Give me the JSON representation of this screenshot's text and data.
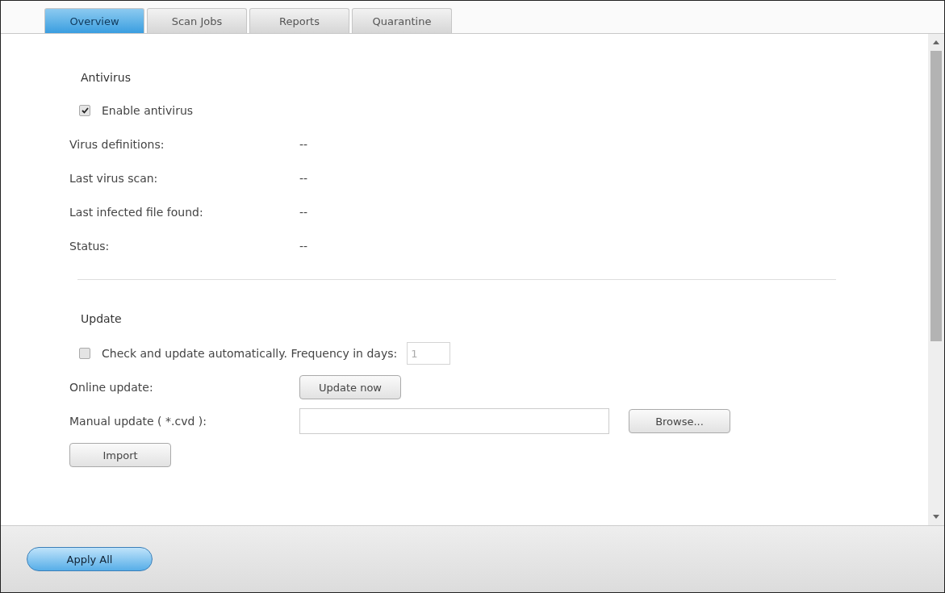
{
  "tabs": [
    {
      "label": "Overview",
      "selected": true
    },
    {
      "label": "Scan Jobs",
      "selected": false
    },
    {
      "label": "Reports",
      "selected": false
    },
    {
      "label": "Quarantine",
      "selected": false
    }
  ],
  "antivirus": {
    "heading": "Antivirus",
    "enable": {
      "label": "Enable antivirus",
      "checked": true
    },
    "rows": [
      {
        "label": "Virus definitions:",
        "value": "--"
      },
      {
        "label": "Last virus scan:",
        "value": "--"
      },
      {
        "label": "Last infected file found:",
        "value": "--"
      },
      {
        "label": "Status:",
        "value": "--"
      }
    ]
  },
  "update": {
    "heading": "Update",
    "auto": {
      "label": "Check and update automatically. Frequency in days:",
      "checked": false,
      "value": "1"
    },
    "online": {
      "label": "Online update:",
      "button": "Update now"
    },
    "manual": {
      "label": "Manual update ( *.cvd ):",
      "browse": "Browse..."
    },
    "import": "Import"
  },
  "footer": {
    "apply": "Apply All"
  }
}
